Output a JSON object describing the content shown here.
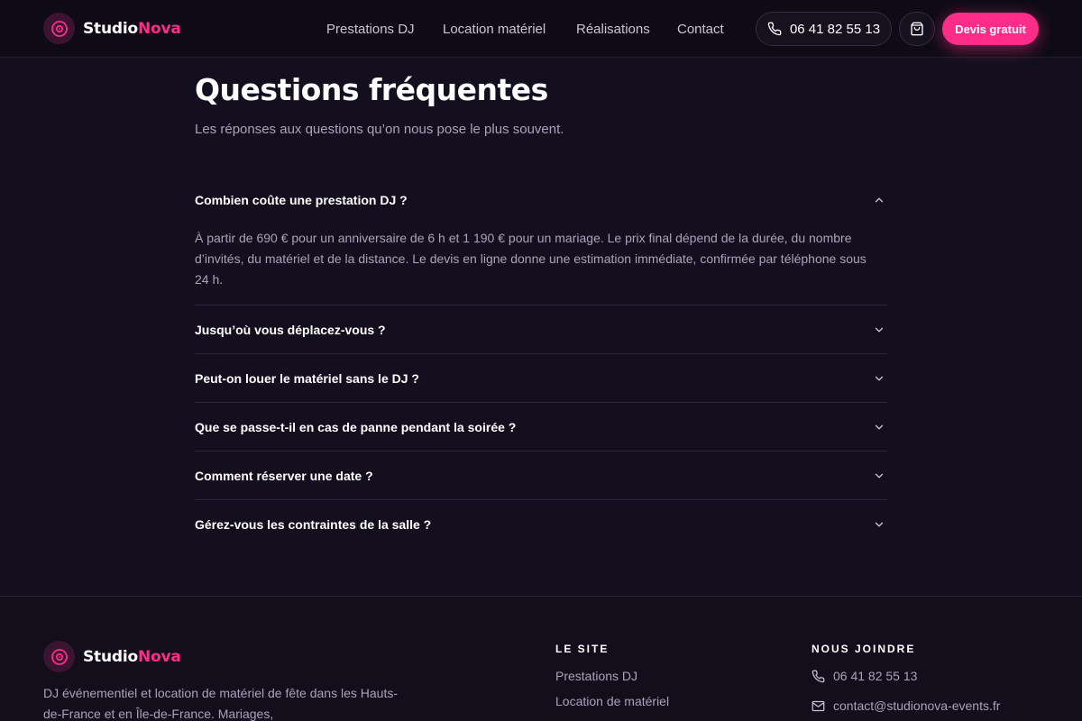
{
  "brand": {
    "name_part1": "Studio",
    "name_part2": "Nova",
    "accent": "#ff2d8a"
  },
  "header": {
    "nav": [
      "Prestations DJ",
      "Location matériel",
      "Réalisations",
      "Contact"
    ],
    "phone": "06 41 82 55 13",
    "cta": "Devis gratuit",
    "icons": {
      "phone": "phone-icon",
      "cart": "shopping-bag-icon",
      "logo": "vinyl-record-icon"
    }
  },
  "faq": {
    "title": "Questions fréquentes",
    "subtitle": "Les réponses aux questions qu’on nous pose le plus souvent.",
    "items": [
      {
        "question": "Combien coûte une prestation DJ ?",
        "answer": "À partir de 690 € pour un anniversaire de 6 h et 1 190 € pour un mariage. Le prix final dépend de la durée, du nombre d’invités, du matériel et de la distance. Le devis en ligne donne une estimation immédiate, confirmée par téléphone sous 24 h.",
        "expanded": true
      },
      {
        "question": "Jusqu’où vous déplacez-vous ?",
        "expanded": false
      },
      {
        "question": "Peut-on louer le matériel sans le DJ ?",
        "expanded": false
      },
      {
        "question": "Que se passe-t-il en cas de panne pendant la soirée ?",
        "expanded": false
      },
      {
        "question": "Comment réserver une date ?",
        "expanded": false
      },
      {
        "question": "Gérez-vous les contraintes de la salle ?",
        "expanded": false
      }
    ]
  },
  "footer": {
    "description": "DJ événementiel et location de matériel de fête dans les Hauts-de-France et en Île-de-France. Mariages,",
    "site_title": "LE SITE",
    "site_links": [
      "Prestations DJ",
      "Location de matériel"
    ],
    "contact_title": "NOUS JOINDRE",
    "contact_phone": "06 41 82 55 13",
    "contact_email": "contact@studionova-events.fr"
  }
}
